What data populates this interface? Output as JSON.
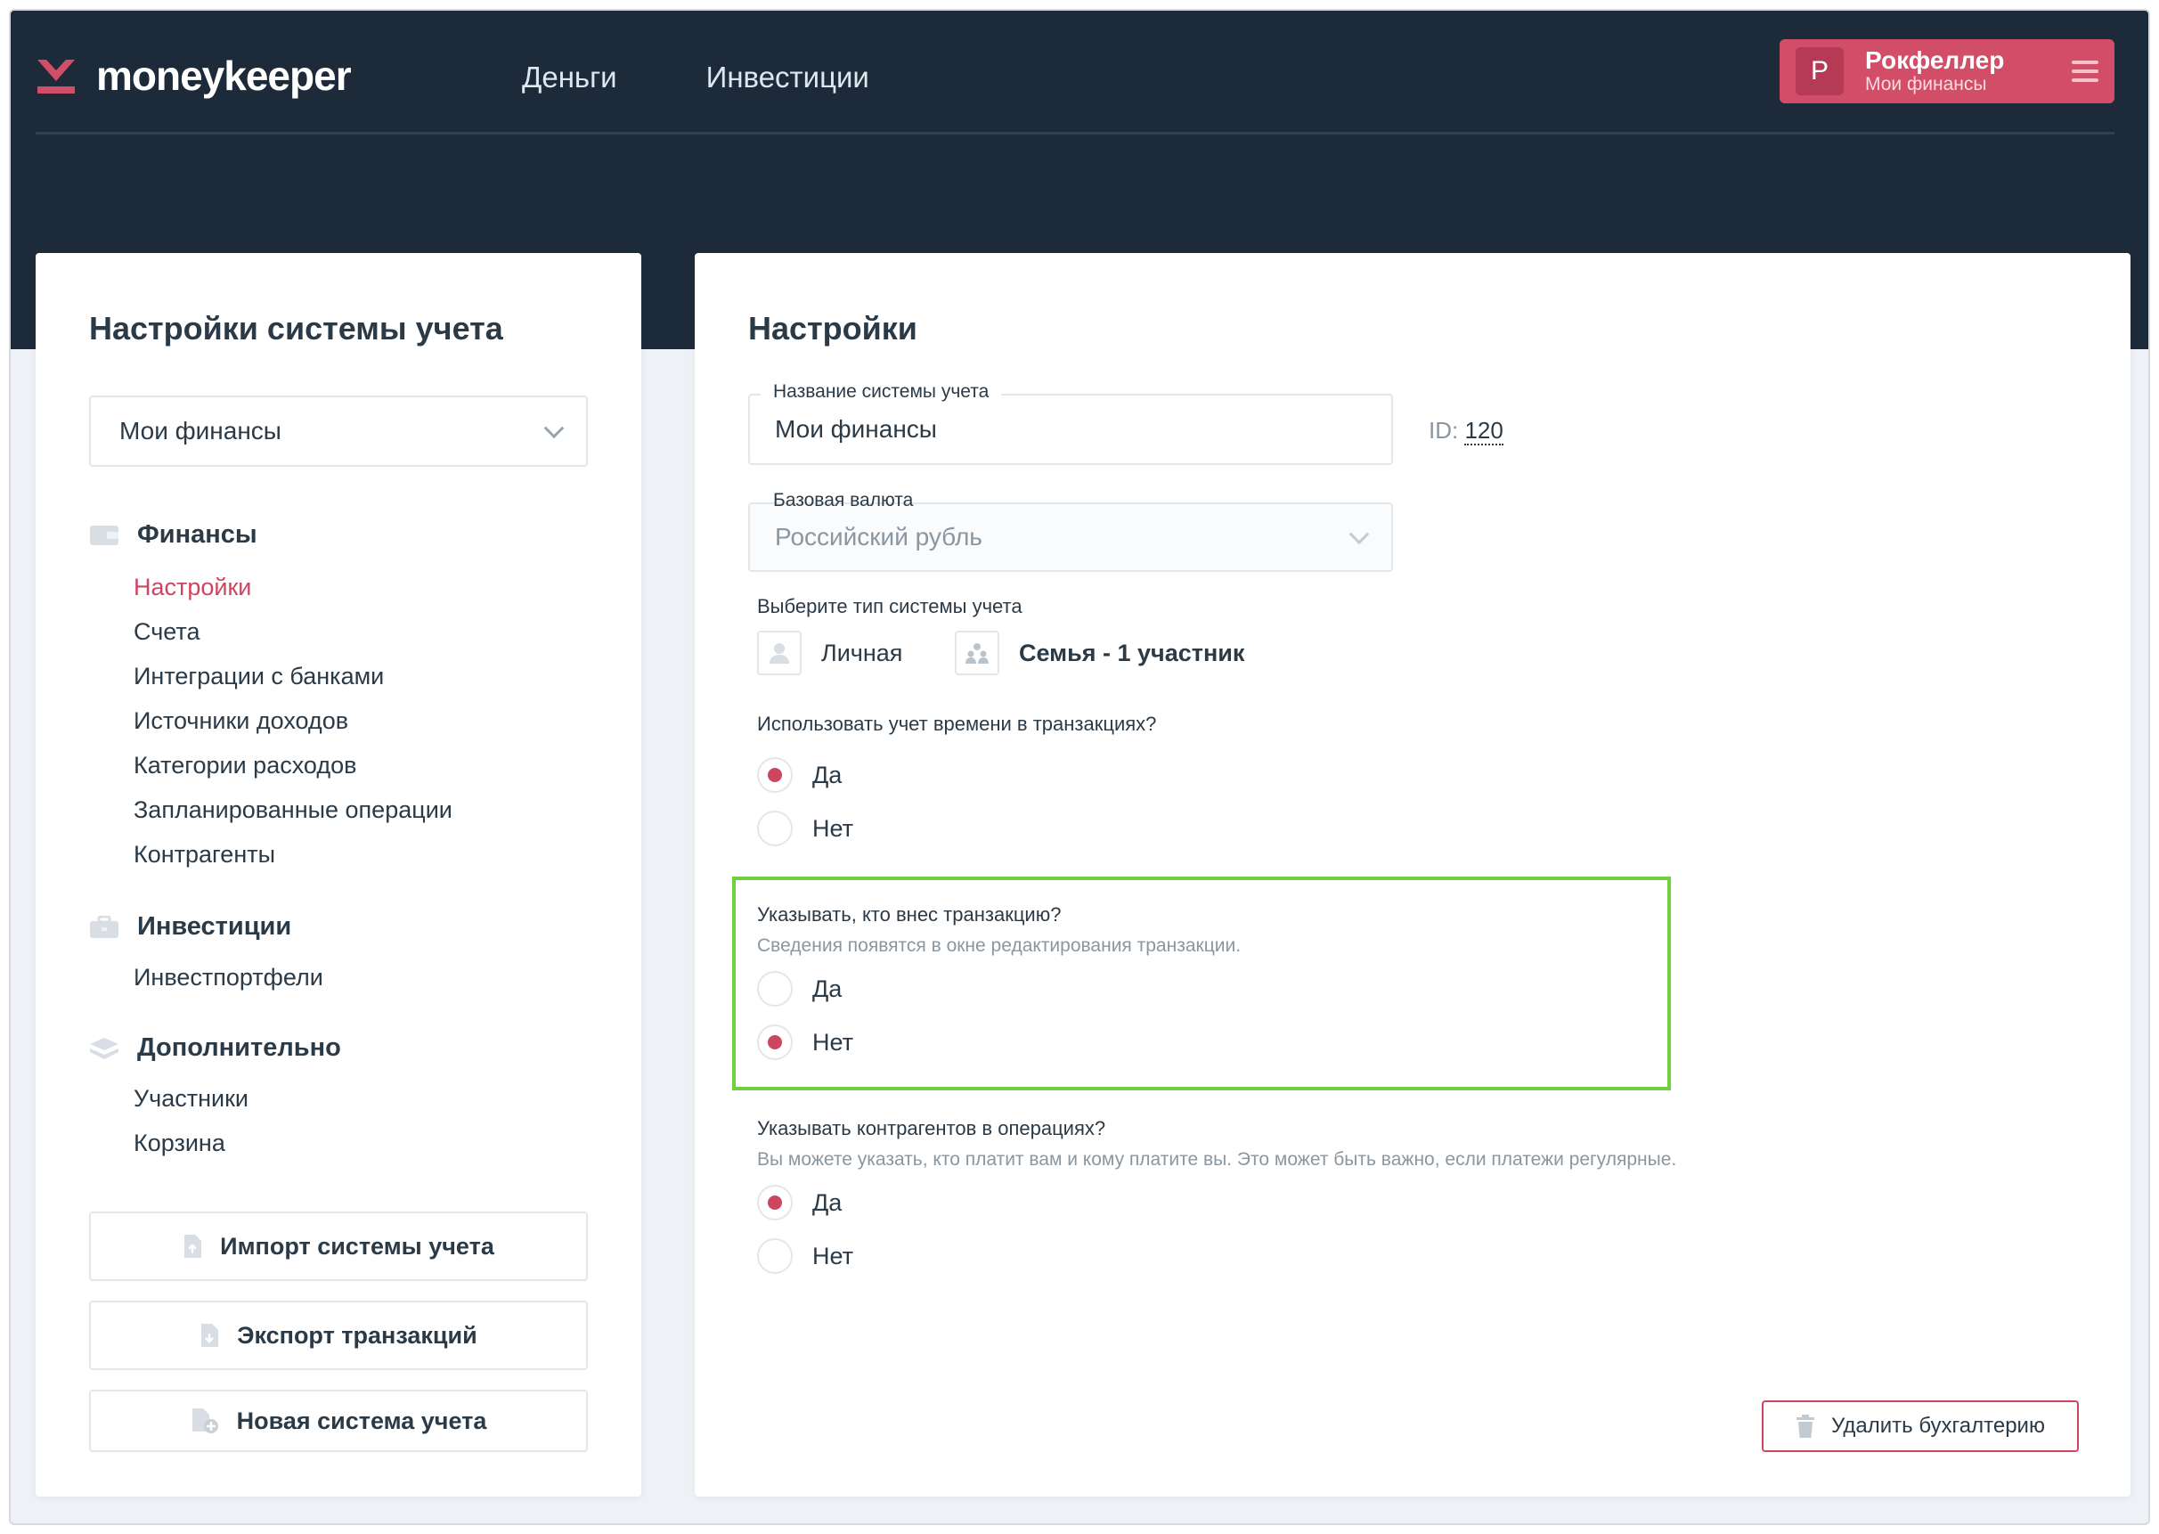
{
  "header": {
    "logo_text": "moneykeeper",
    "nav": [
      {
        "label": "Деньги"
      },
      {
        "label": "Инвестиции"
      }
    ],
    "user": {
      "avatar_letter": "Р",
      "name": "Рокфеллер",
      "subtitle": "Мои финансы"
    }
  },
  "sidebar": {
    "title": "Настройки системы учета",
    "selector_value": "Мои финансы",
    "sections": [
      {
        "title": "Финансы",
        "icon": "wallet-icon",
        "items": [
          "Настройки",
          "Счета",
          "Интеграции с банками",
          "Источники доходов",
          "Категории расходов",
          "Запланированные операции",
          "Контрагенты"
        ],
        "active_index": 0
      },
      {
        "title": "Инвестиции",
        "icon": "briefcase-icon",
        "items": [
          "Инвестпортфели"
        ]
      },
      {
        "title": "Дополнительно",
        "icon": "layers-icon",
        "items": [
          "Участники",
          "Корзина"
        ]
      }
    ],
    "buttons": {
      "import": "Импорт системы учета",
      "export": "Экспорт транзакций",
      "new": "Новая система учета"
    }
  },
  "settings": {
    "title": "Настройки",
    "name_field": {
      "label": "Название системы учета",
      "value": "Мои финансы"
    },
    "id_label": "ID:",
    "id_value": "120",
    "currency_field": {
      "label": "Базовая валюта",
      "value": "Российский рубль"
    },
    "type_question": "Выберите тип системы учета",
    "type_options": [
      {
        "label": "Личная",
        "selected": false
      },
      {
        "label": "Семья - 1 участник",
        "selected": true
      }
    ],
    "time_question": "Использовать учет времени в транзакциях?",
    "time_options": [
      {
        "label": "Да",
        "checked": true
      },
      {
        "label": "Нет",
        "checked": false
      }
    ],
    "author_question": "Указывать, кто внес транзакцию?",
    "author_hint": "Сведения появятся в окне редактирования транзакции.",
    "author_options": [
      {
        "label": "Да",
        "checked": false
      },
      {
        "label": "Нет",
        "checked": true
      }
    ],
    "counterparty_question": "Указывать контрагентов в операциях?",
    "counterparty_hint": "Вы можете указать, кто платит вам и кому платите вы. Это может быть важно, если платежи регулярные.",
    "counterparty_options": [
      {
        "label": "Да",
        "checked": true
      },
      {
        "label": "Нет",
        "checked": false
      }
    ],
    "delete_button": "Удалить бухгалтерию"
  },
  "colors": {
    "header_bg": "#1d2a3a",
    "accent": "#cc4561",
    "highlight": "#6fd13a"
  }
}
